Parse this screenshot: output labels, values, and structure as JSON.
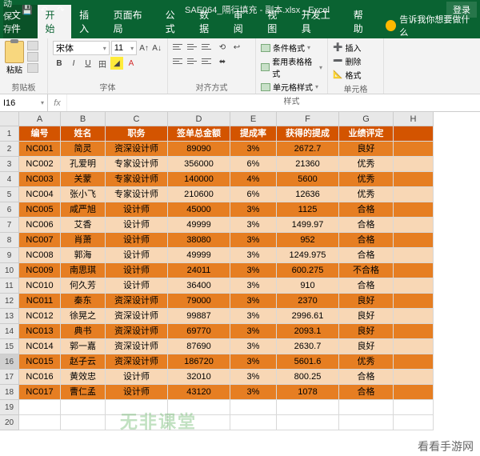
{
  "titlebar": {
    "autosave": "自动保存",
    "title": "SAE064_隔行填充 - 副本.xlsx - Excel",
    "login": "登录"
  },
  "tabs": {
    "file": "文件",
    "home": "开始",
    "insert": "插入",
    "layout": "页面布局",
    "formulas": "公式",
    "data": "数据",
    "review": "审阅",
    "view": "视图",
    "dev": "开发工具",
    "help": "帮助",
    "tellme": "告诉我你想要做什么"
  },
  "ribbon": {
    "clipboard": "剪贴板",
    "paste": "粘贴",
    "font_group": "字体",
    "font_name": "宋体",
    "font_size": "11",
    "align_group": "对齐方式",
    "styles_group": "样式",
    "cond_fmt": "条件格式",
    "table_fmt": "套用表格格式",
    "cell_fmt": "单元格样式",
    "cells_group": "单元格",
    "insert_cell": "插入",
    "delete_cell": "删除",
    "format_cell": "格式"
  },
  "namebox": "I16",
  "columns": [
    "A",
    "B",
    "C",
    "D",
    "E",
    "F",
    "G",
    "H"
  ],
  "headers": [
    "编号",
    "姓名",
    "职务",
    "签单总金额",
    "提成率",
    "获得的提成",
    "业绩评定"
  ],
  "rows": [
    {
      "n": "NC001",
      "name": "简灵",
      "role": "资深设计师",
      "amt": "89090",
      "rate": "3%",
      "comm": "2672.7",
      "eval": "良好"
    },
    {
      "n": "NC002",
      "name": "孔爱明",
      "role": "专家设计师",
      "amt": "356000",
      "rate": "6%",
      "comm": "21360",
      "eval": "优秀"
    },
    {
      "n": "NC003",
      "name": "关蒙",
      "role": "专家设计师",
      "amt": "140000",
      "rate": "4%",
      "comm": "5600",
      "eval": "优秀"
    },
    {
      "n": "NC004",
      "name": "张小飞",
      "role": "专家设计师",
      "amt": "210600",
      "rate": "6%",
      "comm": "12636",
      "eval": "优秀"
    },
    {
      "n": "NC005",
      "name": "咸严旭",
      "role": "设计师",
      "amt": "45000",
      "rate": "3%",
      "comm": "1125",
      "eval": "合格"
    },
    {
      "n": "NC006",
      "name": "艾香",
      "role": "设计师",
      "amt": "49999",
      "rate": "3%",
      "comm": "1499.97",
      "eval": "合格"
    },
    {
      "n": "NC007",
      "name": "肖萧",
      "role": "设计师",
      "amt": "38080",
      "rate": "3%",
      "comm": "952",
      "eval": "合格"
    },
    {
      "n": "NC008",
      "name": "郭海",
      "role": "设计师",
      "amt": "49999",
      "rate": "3%",
      "comm": "1249.975",
      "eval": "合格"
    },
    {
      "n": "NC009",
      "name": "南思琪",
      "role": "设计师",
      "amt": "24011",
      "rate": "3%",
      "comm": "600.275",
      "eval": "不合格"
    },
    {
      "n": "NC010",
      "name": "何久芳",
      "role": "设计师",
      "amt": "36400",
      "rate": "3%",
      "comm": "910",
      "eval": "合格"
    },
    {
      "n": "NC011",
      "name": "秦东",
      "role": "资深设计师",
      "amt": "79000",
      "rate": "3%",
      "comm": "2370",
      "eval": "良好"
    },
    {
      "n": "NC012",
      "name": "徐晃之",
      "role": "资深设计师",
      "amt": "99887",
      "rate": "3%",
      "comm": "2996.61",
      "eval": "良好"
    },
    {
      "n": "NC013",
      "name": "典书",
      "role": "资深设计师",
      "amt": "69770",
      "rate": "3%",
      "comm": "2093.1",
      "eval": "良好"
    },
    {
      "n": "NC014",
      "name": "郭一嘉",
      "role": "资深设计师",
      "amt": "87690",
      "rate": "3%",
      "comm": "2630.7",
      "eval": "良好"
    },
    {
      "n": "NC015",
      "name": "赵子云",
      "role": "资深设计师",
      "amt": "186720",
      "rate": "3%",
      "comm": "5601.6",
      "eval": "优秀"
    },
    {
      "n": "NC016",
      "name": "黄效忠",
      "role": "设计师",
      "amt": "32010",
      "rate": "3%",
      "comm": "800.25",
      "eval": "合格"
    },
    {
      "n": "NC017",
      "name": "曹仁孟",
      "role": "设计师",
      "amt": "43120",
      "rate": "3%",
      "comm": "1078",
      "eval": "合格"
    }
  ],
  "watermark": "无非课堂",
  "brand": "看看手游网"
}
